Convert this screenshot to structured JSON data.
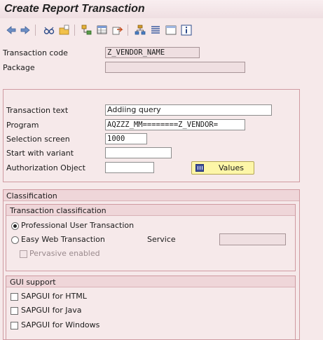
{
  "title": "Create Report Transaction",
  "toolbar": {
    "icons": [
      "back-arrow-icon",
      "forward-arrow-icon",
      "glasses-icon",
      "folder-icon",
      "hierarchy-icon",
      "table-icon",
      "export-icon",
      "tree-icon",
      "list-icon",
      "window-icon",
      "info-icon"
    ]
  },
  "header": {
    "transaction_code_label": "Transaction code",
    "transaction_code_value": "Z_VENDOR_NAME",
    "package_label": "Package",
    "package_value": ""
  },
  "details": {
    "transaction_text_label": "Transaction text",
    "transaction_text_value": "Addiing query",
    "program_label": "Program",
    "program_value": "AQZZZ_MM========Z_VENDOR=",
    "selection_screen_label": "Selection screen",
    "selection_screen_value": "1000",
    "start_variant_label": "Start with variant",
    "start_variant_value": "",
    "auth_object_label": "Authorization Object",
    "auth_object_value": "",
    "values_button": "Values"
  },
  "classification": {
    "title": "Classification",
    "transaction_classification": {
      "title": "Transaction classification",
      "professional_label": "Professional User Transaction",
      "professional_selected": true,
      "easy_web_label": "Easy Web Transaction",
      "easy_web_selected": false,
      "service_label": "Service",
      "service_value": "",
      "pervasive_label": "Pervasive enabled"
    },
    "gui_support": {
      "title": "GUI support",
      "html_label": "SAPGUI for HTML",
      "java_label": "SAPGUI for Java",
      "windows_label": "SAPGUI for Windows"
    }
  }
}
